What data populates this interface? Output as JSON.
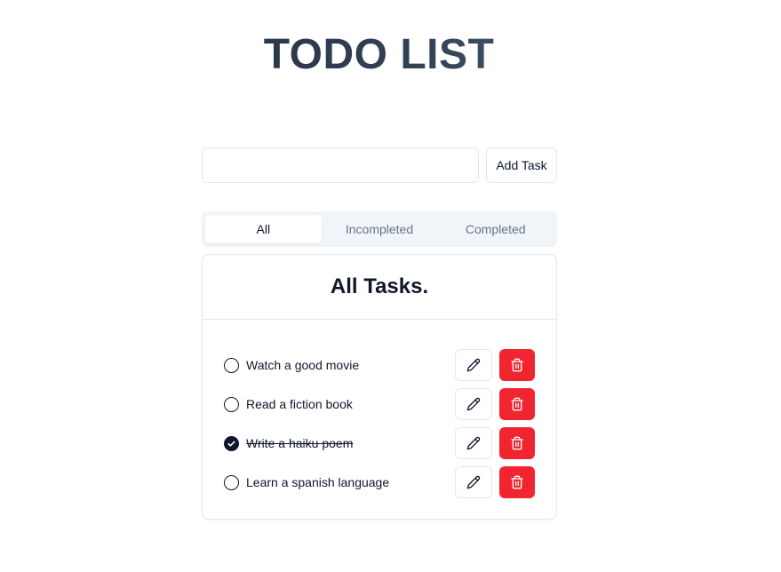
{
  "app": {
    "title": "TODO LIST"
  },
  "add_task": {
    "input_value": "",
    "input_placeholder": "",
    "button_label": "Add Task"
  },
  "tabs": [
    {
      "label": "All",
      "active": true
    },
    {
      "label": "Incompleted",
      "active": false
    },
    {
      "label": "Completed",
      "active": false
    }
  ],
  "card": {
    "title": "All Tasks."
  },
  "tasks": [
    {
      "text": "Watch a good movie",
      "completed": false
    },
    {
      "text": "Read a fiction book",
      "completed": false
    },
    {
      "text": "Write a haiku poem",
      "completed": true
    },
    {
      "text": "Learn a spanish language",
      "completed": false
    }
  ],
  "icons": {
    "checkbox": "circle-checkbox-icon",
    "edit": "pencil-icon",
    "delete": "trash-icon"
  },
  "colors": {
    "delete_button": "#f1252f",
    "text_primary": "#0f172a",
    "text_muted": "#64748b",
    "border": "#e2e8f0",
    "tabs_background": "#f1f5f9"
  }
}
